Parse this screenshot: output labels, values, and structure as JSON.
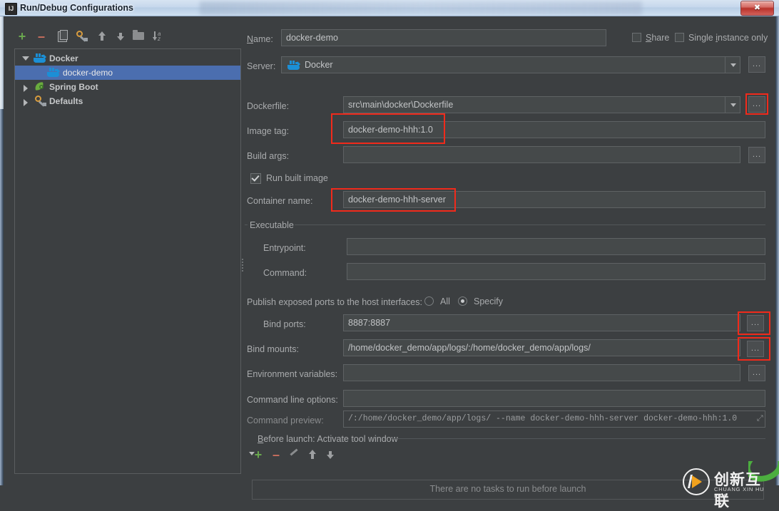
{
  "window": {
    "title": "Run/Debug Configurations",
    "app_icon": "intellij-idea-icon",
    "close_label": "✖"
  },
  "left_panel": {
    "toolbar": [
      {
        "name": "add-configuration-button",
        "icon": "plus-icon",
        "label": "+"
      },
      {
        "name": "remove-configuration-button",
        "icon": "minus-icon",
        "label": "–"
      },
      {
        "name": "copy-configuration-button",
        "icon": "copy-icon",
        "label": ""
      },
      {
        "name": "edit-defaults-button",
        "icon": "wrench-icon",
        "label": ""
      },
      {
        "name": "move-up-button",
        "icon": "arrow-up-icon",
        "label": ""
      },
      {
        "name": "move-down-button",
        "icon": "arrow-down-icon",
        "label": ""
      },
      {
        "name": "create-folder-button",
        "icon": "folder-icon",
        "label": ""
      },
      {
        "name": "sort-configurations-button",
        "icon": "sort-az-icon",
        "label": ""
      }
    ],
    "tree": [
      {
        "label": "Docker",
        "icon": "docker-whale-icon",
        "expanded": true,
        "selected": false,
        "depth": 0
      },
      {
        "label": "docker-demo",
        "icon": "docker-whale-icon",
        "expanded": null,
        "selected": true,
        "depth": 1
      },
      {
        "label": "Spring Boot",
        "icon": "spring-leaf-icon",
        "expanded": false,
        "selected": false,
        "depth": 0
      },
      {
        "label": "Defaults",
        "icon": "wrench-icon",
        "expanded": false,
        "selected": false,
        "depth": 0
      }
    ]
  },
  "form": {
    "name_label": "Name:",
    "name_value": "docker-demo",
    "share_label": "Share",
    "share_checked": false,
    "single_instance_label": "Single instance only",
    "single_instance_checked": false,
    "server_label": "Server:",
    "server_value": "Docker",
    "server_icon": "docker-whale-icon",
    "dockerfile_label": "Dockerfile:",
    "dockerfile_value": "src\\main\\docker\\Dockerfile",
    "image_tag_label": "Image tag:",
    "image_tag_value": "docker-demo-hhh:1.0",
    "build_args_label": "Build args:",
    "build_args_value": "",
    "run_built_image_label": "Run built image",
    "run_built_image_checked": true,
    "container_name_label": "Container name:",
    "container_name_value": "docker-demo-hhh-server",
    "executable_group_label": "Executable",
    "entrypoint_label": "Entrypoint:",
    "entrypoint_value": "",
    "command_label": "Command:",
    "command_value": "",
    "publish_ports_label": "Publish exposed ports to the host interfaces:",
    "publish_all_label": "All",
    "publish_specify_label": "Specify",
    "publish_selected": "Specify",
    "bind_ports_label": "Bind ports:",
    "bind_ports_value": "8887:8887",
    "bind_mounts_label": "Bind mounts:",
    "bind_mounts_value": "/home/docker_demo/app/logs/:/home/docker_demo/app/logs/",
    "env_vars_label": "Environment variables:",
    "env_vars_value": "",
    "cmd_line_options_label": "Command line options:",
    "cmd_line_options_value": "",
    "command_preview_label": "Command preview:",
    "command_preview_value": "/:/home/docker_demo/app/logs/  --name docker-demo-hhh-server docker-demo-hhh:1.0",
    "ellipsis_button_label": "..."
  },
  "before_launch": {
    "title": "Before launch: Activate tool window",
    "toolbar": [
      {
        "name": "add-task-button",
        "icon": "plus-icon"
      },
      {
        "name": "remove-task-button",
        "icon": "minus-icon"
      },
      {
        "name": "edit-task-button",
        "icon": "pencil-icon"
      },
      {
        "name": "move-task-up-button",
        "icon": "arrow-up-icon"
      },
      {
        "name": "move-task-down-button",
        "icon": "arrow-down-icon"
      }
    ],
    "empty_text": "There are no tasks to run before launch"
  },
  "watermark": {
    "cn_text": "创新互联",
    "pinyin_text": "CHUANG XIN HU LIAN"
  },
  "colors": {
    "accent_selection": "#4b6eaf",
    "highlight_red": "#f12a1b",
    "panel_bg": "#3c3f41",
    "field_bg": "#45494a",
    "docker_blue": "#1b8fd6",
    "plus_green": "#6aa84f"
  }
}
